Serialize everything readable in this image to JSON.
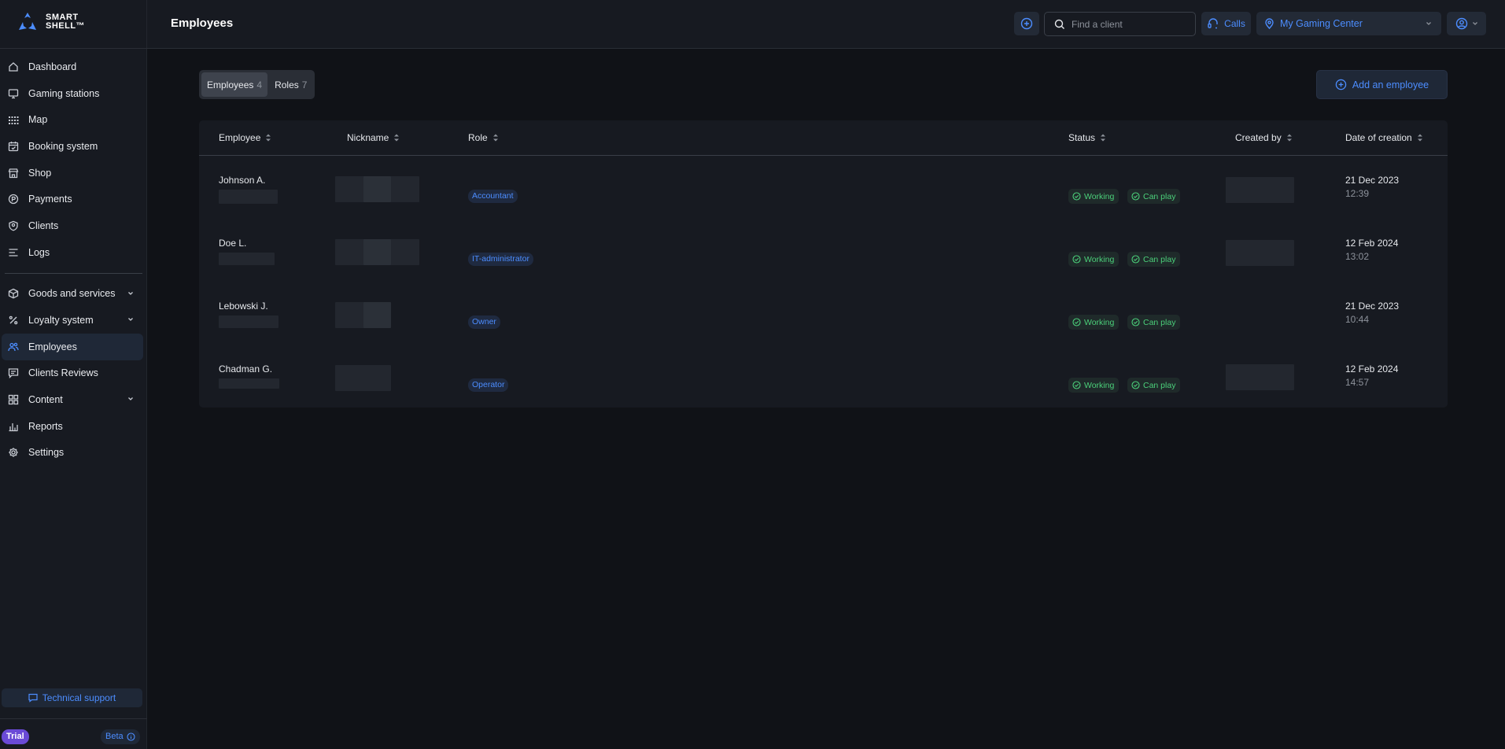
{
  "brand": {
    "line1": "SMART",
    "line2": "SHELL™"
  },
  "header": {
    "title": "Employees",
    "search_placeholder": "Find a client",
    "calls_label": "Calls",
    "center_name": "My Gaming Center"
  },
  "sidebar": {
    "items": [
      {
        "label": "Dashboard",
        "icon": "home-icon"
      },
      {
        "label": "Gaming stations",
        "icon": "monitor-icon"
      },
      {
        "label": "Map",
        "icon": "grid-dots-icon"
      },
      {
        "label": "Booking system",
        "icon": "calendar-icon"
      },
      {
        "label": "Shop",
        "icon": "store-icon"
      },
      {
        "label": "Payments",
        "icon": "coin-icon"
      },
      {
        "label": "Clients",
        "icon": "shield-user-icon"
      },
      {
        "label": "Logs",
        "icon": "lines-icon"
      }
    ],
    "items2": [
      {
        "label": "Goods and services",
        "icon": "cube-icon",
        "expandable": true
      },
      {
        "label": "Loyalty system",
        "icon": "percent-icon",
        "expandable": true
      },
      {
        "label": "Employees",
        "icon": "users-icon",
        "active": true
      },
      {
        "label": "Clients Reviews",
        "icon": "message-icon"
      },
      {
        "label": "Content",
        "icon": "tiles-icon",
        "expandable": true
      },
      {
        "label": "Reports",
        "icon": "bar-chart-icon"
      },
      {
        "label": "Settings",
        "icon": "gear-icon"
      }
    ],
    "support_label": "Technical support",
    "trial_label": "Trial",
    "beta_label": "Beta"
  },
  "tabs": [
    {
      "label": "Employees",
      "count": "4",
      "active": true
    },
    {
      "label": "Roles",
      "count": "7",
      "active": false
    }
  ],
  "add_button_label": "Add an employee",
  "table": {
    "columns": {
      "employee": "Employee",
      "nickname": "Nickname",
      "role": "Role",
      "status": "Status",
      "created_by": "Created by",
      "date": "Date of creation"
    },
    "rows": [
      {
        "name": "Johnson A.",
        "role": "Accountant",
        "status": "Working",
        "play": "Can play",
        "date": "21 Dec 2023",
        "time": "12:39"
      },
      {
        "name": "Doe L.",
        "role": "IT-administrator",
        "status": "Working",
        "play": "Can play",
        "date": "12 Feb 2024",
        "time": "13:02"
      },
      {
        "name": "Lebowski J.",
        "role": "Owner",
        "status": "Working",
        "play": "Can play",
        "date": "21 Dec 2023",
        "time": "10:44"
      },
      {
        "name": "Chadman G.",
        "role": "Operator",
        "status": "Working",
        "play": "Can play",
        "date": "12 Feb 2024",
        "time": "14:57"
      }
    ]
  },
  "colors": {
    "accent": "#4c8dff",
    "status_green": "#4bd07a",
    "trial": "#6a4ad6",
    "background": "#101217",
    "panel": "#171a21"
  }
}
